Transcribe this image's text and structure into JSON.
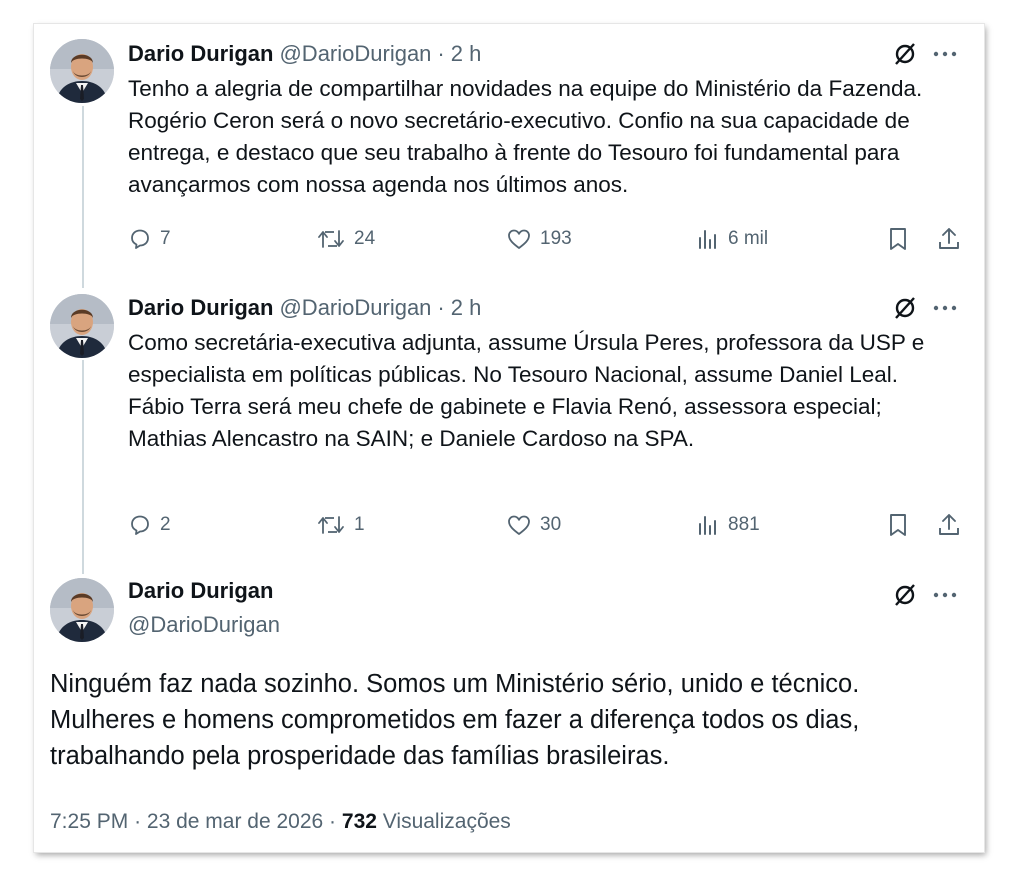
{
  "tweets": [
    {
      "name": "Dario Durigan",
      "handle": "@DarioDurigan",
      "separator": "·",
      "time": "2 h",
      "text": "Tenho a alegria de compartilhar novidades na equipe do Ministério da Fazenda. Rogério Ceron será o novo secretário-executivo. Confio na sua capacidade de entrega, e destaco que seu trabalho à frente do Tesouro foi fundamental para avançarmos com nossa agenda nos últimos anos.",
      "replies": "7",
      "retweets": "24",
      "likes": "193",
      "views": "6 mil"
    },
    {
      "name": "Dario Durigan",
      "handle": "@DarioDurigan",
      "separator": "·",
      "time": "2 h",
      "text": "Como secretária-executiva adjunta, assume Úrsula Peres, professora da USP e especialista em políticas públicas. No Tesouro Nacional, assume Daniel Leal. Fábio Terra será meu chefe de gabinete e Flavia Renó, assessora especial; Mathias Alencastro na SAIN; e Daniele Cardoso na SPA.",
      "replies": "2",
      "retweets": "1",
      "likes": "30",
      "views": "881"
    }
  ],
  "main": {
    "name": "Dario Durigan",
    "handle": "@DarioDurigan",
    "text": "Ninguém faz nada sozinho. Somos um Ministério sério, unido e técnico. Mulheres e homens comprometidos em fazer a diferença todos os dias, trabalhando pela prosperidade das famílias brasileiras.",
    "time": "7:25 PM",
    "separator": "·",
    "date": "23 de mar de 2026",
    "views_count": "732",
    "views_label": "Visualizações"
  },
  "icons": {
    "grok": "grok-icon",
    "more": "more-icon",
    "reply": "reply-icon",
    "retweet": "retweet-icon",
    "like": "like-icon",
    "views": "views-icon",
    "bookmark": "bookmark-icon",
    "share": "share-icon"
  },
  "colors": {
    "text": "#0f1419",
    "secondary": "#536471",
    "thread_line": "#cfd9de"
  }
}
